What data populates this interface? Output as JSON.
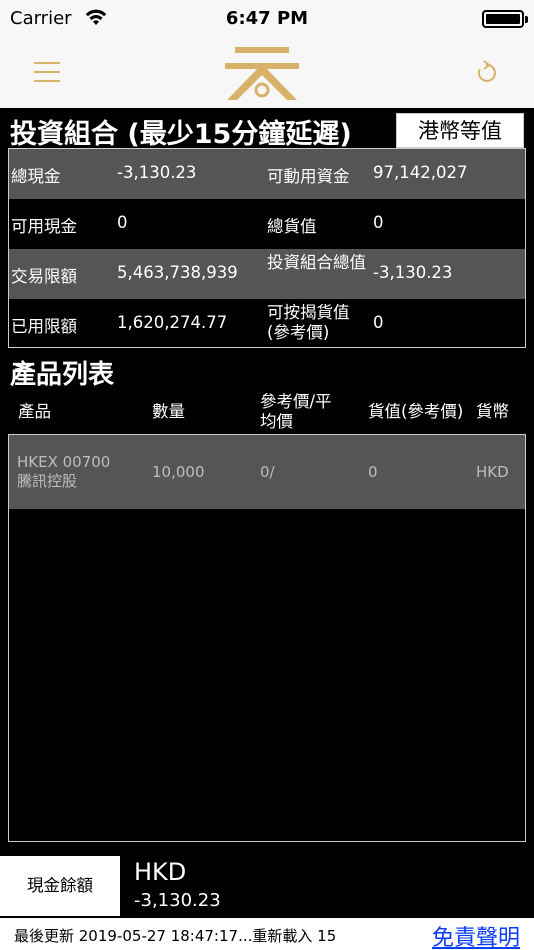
{
  "status_bar": {
    "carrier": "Carrier",
    "time": "6:47 PM"
  },
  "nav": {
    "menu_icon": "menu-icon",
    "logo_icon": "logo-icon",
    "refresh_icon": "refresh-icon",
    "accent_color": "#d9b26a"
  },
  "portfolio": {
    "title": "投資組合 (最少15分鐘延遲)",
    "currency_button": "港幣等值",
    "rows": [
      {
        "l1": "總現金",
        "v1": "-3,130.23",
        "l2": "可動用資金",
        "v2": "97,142,027"
      },
      {
        "l1": "可用現金",
        "v1": "0",
        "l2": "總貨值",
        "v2": "0"
      },
      {
        "l1": "交易限額",
        "v1": "5,463,738,939",
        "l2": "投資組合總值",
        "v2": "-3,130.23"
      },
      {
        "l1": "已用限額",
        "v1": "1,620,274.77",
        "l2": "可按揭貨值(參考價)",
        "v2": "0"
      }
    ]
  },
  "products": {
    "title": "產品列表",
    "headers": {
      "product": "產品",
      "quantity": "數量",
      "ref_price": "參考價/平均價",
      "value": "貨值(參考價)",
      "currency": "貨幣"
    },
    "items": [
      {
        "code": "HKEX 00700",
        "name": "騰訊控股",
        "quantity": "10,000",
        "price": "0/",
        "value": "0",
        "currency": "HKD"
      }
    ]
  },
  "cash_balance": {
    "button": "現金餘額",
    "currency": "HKD",
    "value": "-3,130.23"
  },
  "footer": {
    "last_updated": "最後更新 2019-05-27 18:47:17...重新載入 15",
    "disclaimer": "免責聲明",
    "link_color": "#0a3cff"
  }
}
